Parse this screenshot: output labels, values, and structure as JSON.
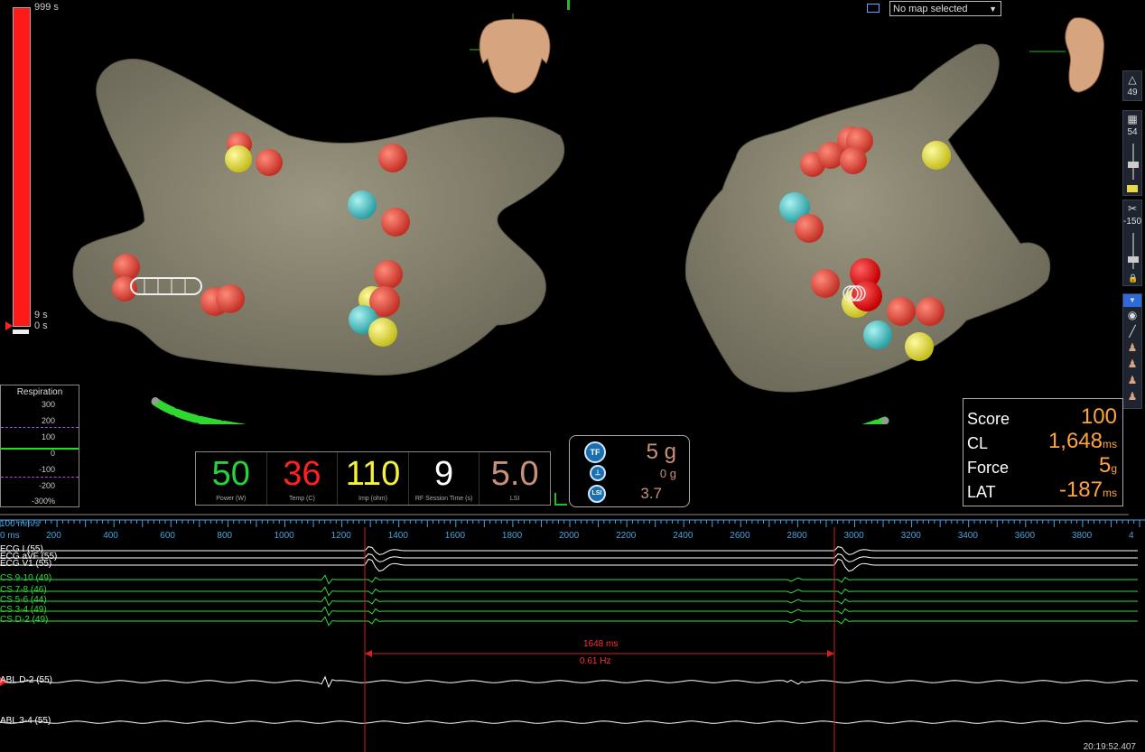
{
  "timeline": {
    "top_label": "999 s",
    "mid_label": "9 s",
    "bottom_label": "0 s"
  },
  "map_selector": {
    "value": "No map selected"
  },
  "toolbar": {
    "opacity_value": "49",
    "transparency_value": "54",
    "clip_value": "-150"
  },
  "respiration": {
    "title": "Respiration",
    "ticks": [
      "300",
      "200",
      "100",
      "0",
      "-100",
      "-200",
      "-300%"
    ]
  },
  "ablation": {
    "cells": [
      {
        "value": "50",
        "label": "Power (W)",
        "color": "#25d43a"
      },
      {
        "value": "36",
        "label": "Temp (C)",
        "color": "#ff2020"
      },
      {
        "value": "110",
        "label": "Imp (ohm)",
        "color": "#f5f03a"
      },
      {
        "value": "9",
        "label": "RF Session Time (s)",
        "color": "#ffffff"
      },
      {
        "value": "5.0",
        "label": "LSI",
        "color": "#c8927a"
      }
    ]
  },
  "force": {
    "tf_badge": "TF",
    "tf_value": "5 g",
    "axial_value": "0 g",
    "lsi_badge": "LSI",
    "lsi_value": "3.7"
  },
  "score": {
    "rows": [
      {
        "key": "Score",
        "value": "100",
        "unit": ""
      },
      {
        "key": "CL",
        "value": "1,648",
        "unit": "ms"
      },
      {
        "key": "Force",
        "value": "5",
        "unit": "g"
      },
      {
        "key": "LAT",
        "value": "-187",
        "unit": "ms"
      }
    ]
  },
  "signals": {
    "sweep_speed": "100 mm/s",
    "ruler": [
      "0 ms",
      "200",
      "400",
      "600",
      "800",
      "1000",
      "1200",
      "1400",
      "1600",
      "1800",
      "2000",
      "2200",
      "2400",
      "2600",
      "2800",
      "3000",
      "3200",
      "3400",
      "3600",
      "3800",
      "4"
    ],
    "channels": [
      {
        "label": "ECG I (55)",
        "color": "#ffffff"
      },
      {
        "label": "ECG aVF (55)",
        "color": "#ffffff"
      },
      {
        "label": "ECG V1 (55)",
        "color": "#ffffff"
      },
      {
        "label": "CS  9-10 (49)",
        "color": "#2edc3a"
      },
      {
        "label": "CS  7-8 (46)",
        "color": "#2edc3a"
      },
      {
        "label": "CS  5-6 (44)",
        "color": "#2edc3a"
      },
      {
        "label": "CS  3-4 (49)",
        "color": "#2edc3a"
      },
      {
        "label": "CS  D-2 (49)",
        "color": "#2edc3a"
      },
      {
        "label": "ABL  D-2 (55)",
        "color": "#ffffff"
      },
      {
        "label": "ABL  3-4 (55)",
        "color": "#ffffff"
      }
    ],
    "caliper_ms": "1648 ms",
    "caliper_hz": "0.61 Hz",
    "clock": "20:19:52.407"
  },
  "colors": {
    "anatomy": "#8a8674",
    "lesion_red": "#e0453a",
    "lesion_yellow": "#e8e03a",
    "lesion_cyan": "#4cc6c8",
    "catheter": "#2ed82e",
    "accent_orange": "#ffa43a"
  }
}
